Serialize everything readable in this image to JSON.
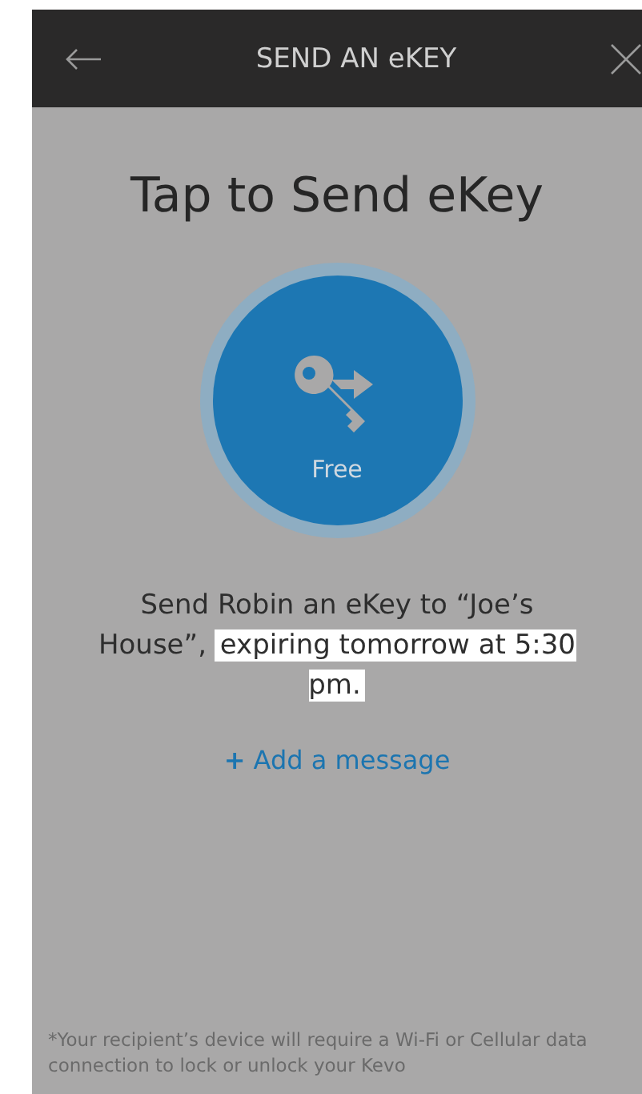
{
  "header": {
    "title": "SEND AN eKEY"
  },
  "heading": "Tap to Send eKey",
  "send_button": {
    "label": "Free"
  },
  "message": {
    "text": "Send Robin an eKey to “Joe’s House”,",
    "highlight": "expiring tomorrow at 5:30 pm."
  },
  "add_message_link": {
    "icon": "+",
    "label": "Add a message"
  },
  "footnote": "*Your recipient’s device will require a Wi-Fi or Cellular data connection to lock or unlock your Kevo"
}
